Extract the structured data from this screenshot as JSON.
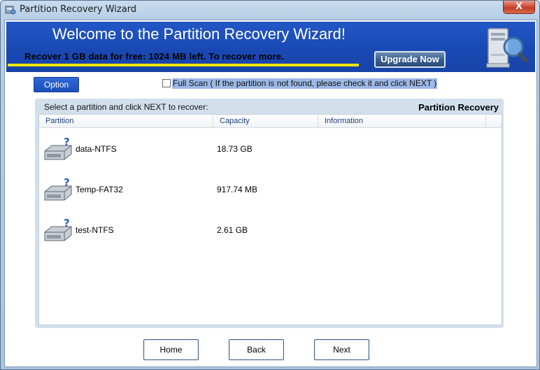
{
  "window": {
    "title": "Partition Recovery Wizard",
    "close_symbol": "X"
  },
  "banner": {
    "title": "Welcome to the Partition Recovery Wizard!",
    "subtitle": "Recover 1 GB data for free: 1024 MB left. To recover more.",
    "upgrade_label": "Upgrade Now",
    "icon": "computer-magnifier-icon",
    "accent_color": "#1a49b4",
    "underline_color": "#f7e400"
  },
  "options": {
    "option_label": "Option",
    "full_scan_checked": false,
    "full_scan_label": "Full Scan ( If the partition is not found, please check it and click NEXT )"
  },
  "panel": {
    "hint": "Select a partition and click NEXT to recover:",
    "title": "Partition Recovery",
    "columns": [
      "Partition",
      "Capacity",
      "Information"
    ],
    "rows": [
      {
        "icon": "hard-drive-question-icon",
        "name": "data-NTFS",
        "capacity": "18.73 GB",
        "info": ""
      },
      {
        "icon": "hard-drive-question-icon",
        "name": "Temp-FAT32",
        "capacity": "917.74 MB",
        "info": ""
      },
      {
        "icon": "hard-drive-question-icon",
        "name": "test-NTFS",
        "capacity": "2.61 GB",
        "info": ""
      }
    ]
  },
  "footer": {
    "home_label": "Home",
    "back_label": "Back",
    "next_label": "Next"
  }
}
